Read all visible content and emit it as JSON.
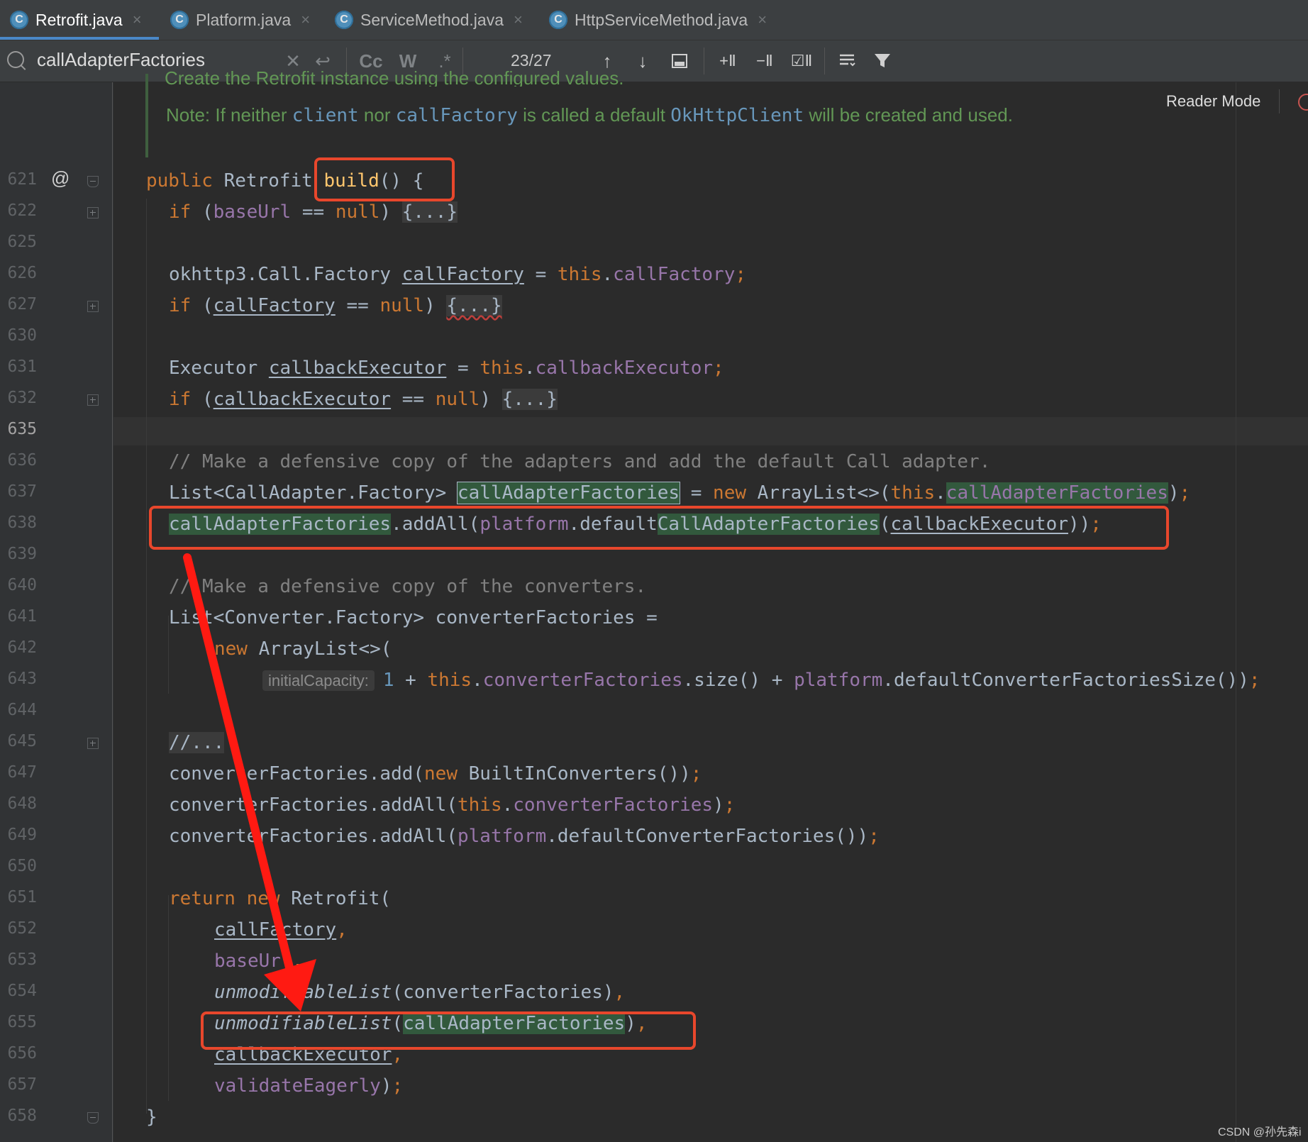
{
  "tabs": [
    {
      "label": "Retrofit.java",
      "active": true
    },
    {
      "label": "Platform.java",
      "active": false
    },
    {
      "label": "ServiceMethod.java",
      "active": false
    },
    {
      "label": "HttpServiceMethod.java",
      "active": false
    }
  ],
  "find": {
    "query": "callAdapterFactories",
    "match_case": "Cc",
    "words": "W",
    "regex": ".*",
    "match_count": "23/27"
  },
  "reader_mode": "Reader Mode",
  "doc": {
    "clipped": "Create the Retrofit instance using the configured values.",
    "p1": "Note: If neither ",
    "c1": "client",
    "p2": " nor ",
    "c2": "callFactory",
    "p3": " is called a default ",
    "c3": "OkHttpClient",
    "p4": " will be created and used."
  },
  "line_numbers": [
    "621",
    "622",
    "625",
    "626",
    "627",
    "630",
    "631",
    "632",
    "635",
    "636",
    "637",
    "638",
    "639",
    "640",
    "641",
    "642",
    "643",
    "644",
    "645",
    "647",
    "648",
    "649",
    "650",
    "651",
    "652",
    "653",
    "654",
    "655",
    "656",
    "657",
    "658"
  ],
  "current_line": "635",
  "hint_label": "initialCapacity:",
  "watermark": "CSDN @孙先森i",
  "colors": {
    "keyword": "#cc7832",
    "field": "#9876aa",
    "method": "#ffc66d",
    "number": "#6897bb",
    "comment": "#808080",
    "doc": "#629755",
    "search_highlight": "#32593d",
    "annotation": "#e8472c"
  }
}
